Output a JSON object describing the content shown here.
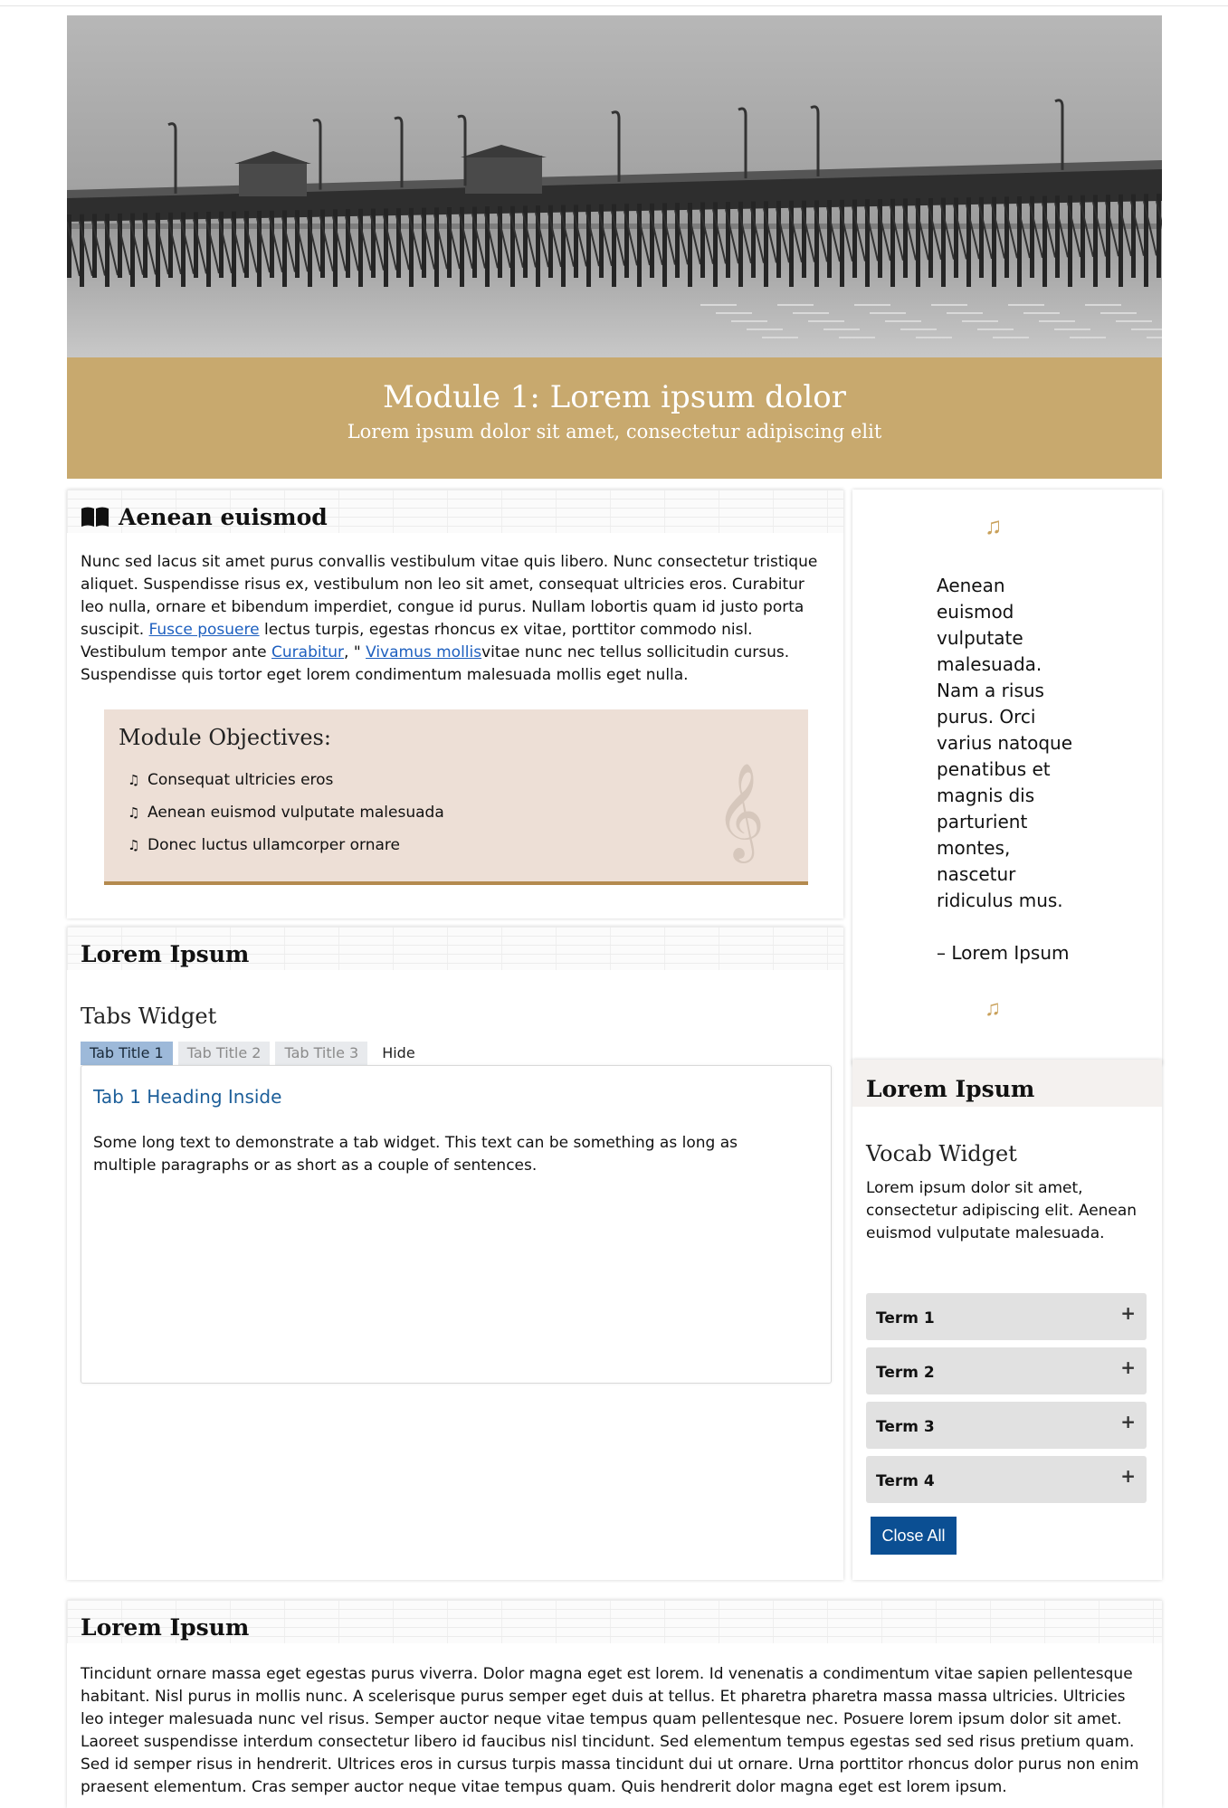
{
  "hero": {
    "image_alt": "pier photograph"
  },
  "banner": {
    "title": "Module 1: Lorem ipsum dolor",
    "subtitle": "Lorem ipsum dolor sit amet, consectetur adipiscing elit",
    "color": "#c8a96e"
  },
  "intro": {
    "heading": "Aenean euismod",
    "icon": "book-open-icon",
    "p1": "Nunc sed lacus sit amet purus convallis vestibulum vitae quis libero. Nunc consectetur tristique aliquet. Suspendisse risus ex, vestibulum non leo sit amet, consequat ultricies eros. Curabitur leo nulla, ornare et bibendum imperdiet, congue id purus. Nullam lobortis quam id justo porta suscipit. ",
    "link1": "Fusce posuere",
    "p2": " lectus turpis, egestas rhoncus ex vitae, porttitor commodo nisl. Vestibulum tempor ante ",
    "link2": "Curabitur",
    "p3": ", \" ",
    "link3": "Vivamus mollis",
    "p4": "vitae nunc nec tellus sollicitudin cursus. Suspendisse quis tortor eget lorem condimentum malesuada mollis eget nulla."
  },
  "objectives": {
    "title": "Module Objectives:",
    "items": [
      "Consequat ultricies eros",
      "Aenean euismod vulputate malesuada",
      "Donec luctus ullamcorper ornare"
    ],
    "accent": "#b48a4e"
  },
  "tabs_card": {
    "heading": "Lorem Ipsum",
    "widget_title": "Tabs Widget",
    "tabs": [
      "Tab Title 1",
      "Tab Title 2",
      "Tab Title 3"
    ],
    "hide_label": "Hide",
    "panel_heading": "Tab 1 Heading Inside",
    "panel_text": "Some long text to demonstrate a tab widget. This text can be something as long as multiple paragraphs or as short as a couple of sentences."
  },
  "quote": {
    "text": "Aenean euismod vulputate malesuada. Nam a risus purus. Orci varius natoque penatibus et magnis dis parturient montes, nascetur ridiculus mus.",
    "attribution": "– Lorem Ipsum",
    "accent": "#c9a15b"
  },
  "vocab_card": {
    "heading": "Lorem Ipsum",
    "widget_title": "Vocab Widget",
    "text": "Lorem ipsum dolor sit amet, consectetur adipiscing elit. Aenean euismod vulputate malesuada.",
    "terms": [
      "Term 1",
      "Term 2",
      "Term 3",
      "Term 4"
    ],
    "expand_symbol": "+",
    "close_all": "Close All"
  },
  "bottom_card": {
    "heading": "Lorem Ipsum",
    "text": "Tincidunt ornare massa eget egestas purus viverra. Dolor magna eget est lorem. Id venenatis a condimentum vitae sapien pellentesque habitant. Nisl purus in mollis nunc. A scelerisque purus semper eget duis at tellus. Et pharetra pharetra massa massa ultricies. Ultricies leo integer malesuada nunc vel risus. Semper auctor neque vitae tempus quam pellentesque nec. Posuere lorem ipsum dolor sit amet. Laoreet suspendisse interdum consectetur libero id faucibus nisl tincidunt. Sed elementum tempus egestas sed sed risus pretium quam. Sed id semper risus in hendrerit. Ultrices eros in cursus turpis massa tincidunt dui ut ornare. Urna porttitor rhoncus dolor purus non enim praesent elementum. Cras semper auctor neque vitae tempus quam. Quis hendrerit dolor magna eget est lorem ipsum."
  }
}
